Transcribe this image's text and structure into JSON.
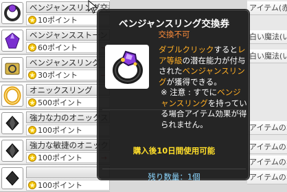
{
  "shop": {
    "items": [
      {
        "name": "ベンジャンスリング交換券",
        "price": "10ポイント",
        "icon": "ring-voucher-icon"
      },
      {
        "name": "ベンジャンスストーン",
        "price": "60ポイント",
        "icon": "purple-gem-icon"
      },
      {
        "name": "ベンジャンスリング",
        "price": "30ポイント",
        "icon": "gold-box-icon"
      },
      {
        "name": "オニックスリング",
        "price": "500ポイント",
        "icon": "gold-ring-icon"
      },
      {
        "name": "強力な力のオニックスストーン",
        "price": "100ポイント",
        "icon": "onyx-stone-icon"
      },
      {
        "name": "強力な敏捷のオニックスストーン",
        "price": "100ポイント",
        "icon": "onyx-stone-icon"
      },
      {
        "name": "",
        "price": "100ポイント",
        "icon": "onyx-stone-icon"
      }
    ],
    "arrow": "→"
  },
  "background_right": {
    "rows": [
      "アイテム(赤)",
      "白い魔法(いの朝",
      "白い魔法(いの朝",
      "アイテムのポイズ",
      "アイテムのポイズ",
      "アイテムのポイズ",
      "アイテムのポイズ"
    ]
  },
  "tooltip": {
    "title": "ベンジャンスリング交換券",
    "subtitle": "交換不可",
    "desc_a": "ダブルクリック",
    "desc_b": "すると",
    "desc_c": "レア等級",
    "desc_d": "の潜在能力が付与された",
    "desc_e": "ベンジャンスリング",
    "desc_f": "が獲得できる。",
    "note_label": "※ 注意 :",
    "note_a": "すでに",
    "note_b": "ベンジャンスリング",
    "note_c": "を持っている場合アイテム効果が得られません。",
    "period": "購入後10日間使用可能",
    "stock": "残り数量：1個"
  }
}
